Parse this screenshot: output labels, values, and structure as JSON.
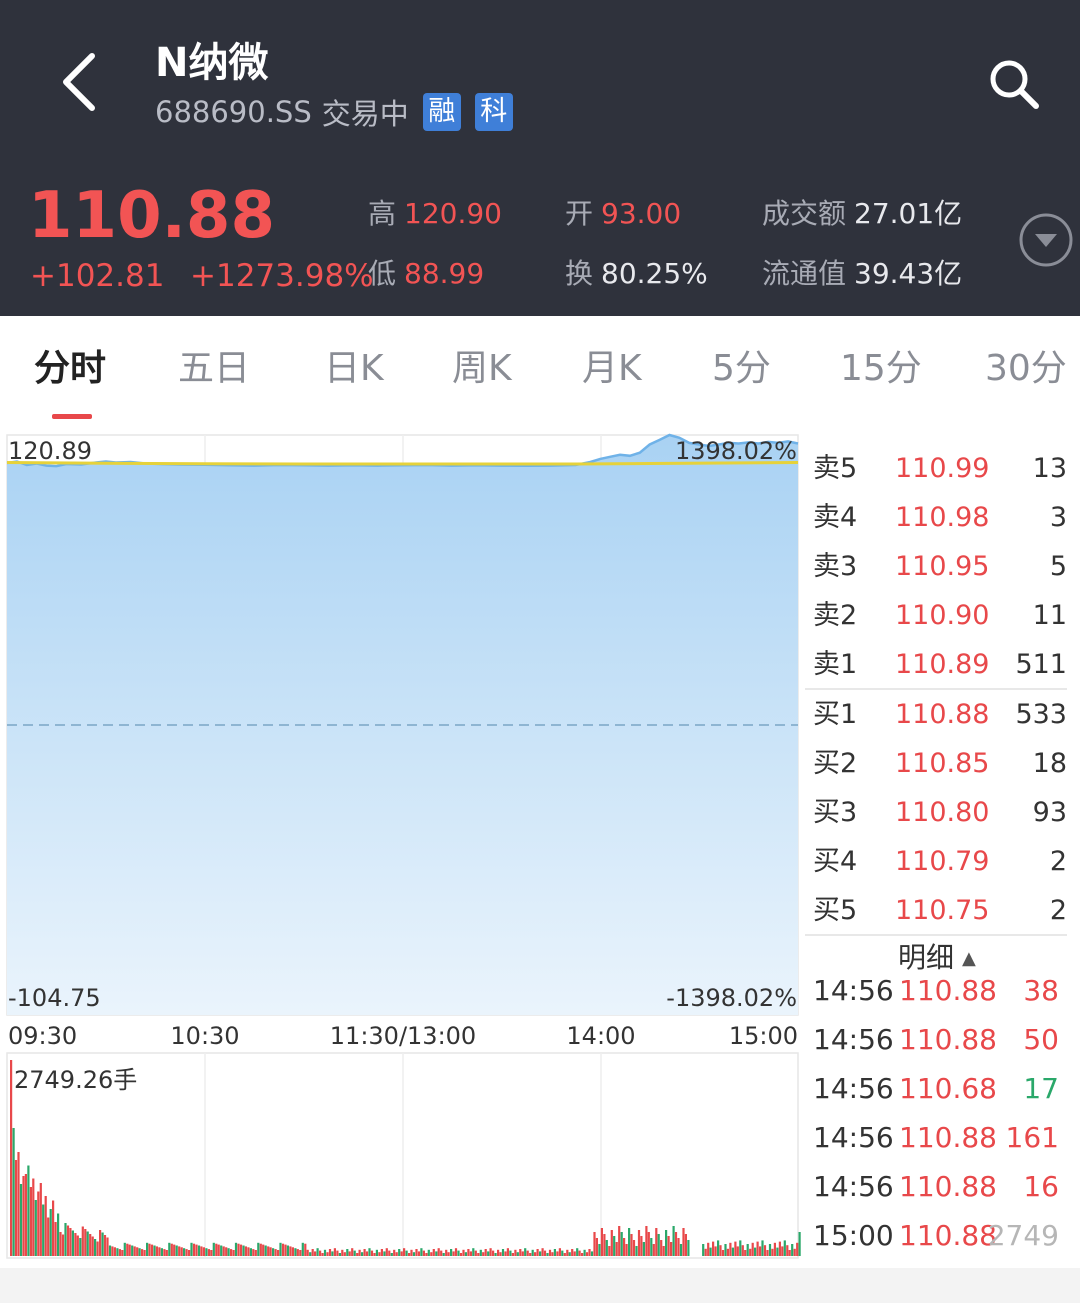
{
  "header": {
    "name": "N纳微",
    "code": "688690.SS",
    "status": "交易中",
    "badges": [
      "融",
      "科"
    ]
  },
  "quote": {
    "price": "110.88",
    "change": "+102.81",
    "change_pct": "+1273.98%",
    "high_label": "高",
    "high": "120.90",
    "low_label": "低",
    "low": "88.99",
    "open_label": "开",
    "open": "93.00",
    "turnover_label": "换",
    "turnover": "80.25%",
    "amount_label": "成交额",
    "amount": "27.01亿",
    "float_label": "流通值",
    "float_value": "39.43亿"
  },
  "tabs": [
    "分时",
    "五日",
    "日K",
    "周K",
    "月K",
    "5分",
    "15分",
    "30分"
  ],
  "chart": {
    "top_price": "120.89",
    "bottom_price": "-104.75",
    "top_pct": "1398.02%",
    "bottom_pct": "-1398.02%",
    "time_labels": [
      "09:30",
      "10:30",
      "11:30/13:00",
      "14:00",
      "15:00"
    ],
    "volume_label": "2749.26手"
  },
  "chart_data": {
    "type": "line",
    "x_label_ticks": [
      "09:30",
      "10:30",
      "11:30/13:00",
      "14:00",
      "15:00"
    ],
    "ylim": [
      -104.75,
      120.89
    ],
    "series": [
      {
        "values": [
          [
            0,
            110.0
          ],
          [
            4,
            110.6
          ],
          [
            8,
            109.2
          ],
          [
            12,
            109.8
          ],
          [
            16,
            109.0
          ],
          [
            20,
            108.8
          ],
          [
            24,
            109.6
          ],
          [
            30,
            109.4
          ],
          [
            36,
            110.2
          ],
          [
            40,
            110.6
          ],
          [
            44,
            110.2
          ],
          [
            50,
            110.4
          ],
          [
            56,
            109.8
          ],
          [
            62,
            109.6
          ],
          [
            70,
            109.4
          ],
          [
            80,
            109.3
          ],
          [
            90,
            109.1
          ],
          [
            100,
            109.0
          ],
          [
            110,
            109.2
          ],
          [
            120,
            109.1
          ],
          [
            130,
            109.0
          ],
          [
            140,
            109.1
          ],
          [
            150,
            109.0
          ],
          [
            160,
            109.1
          ],
          [
            170,
            109.2
          ],
          [
            180,
            109.0
          ],
          [
            190,
            109.1
          ],
          [
            200,
            109.0
          ],
          [
            210,
            108.9
          ],
          [
            220,
            109.0
          ],
          [
            230,
            109.2
          ],
          [
            236,
            110.4
          ],
          [
            240,
            111.6
          ],
          [
            244,
            112.4
          ],
          [
            248,
            113.2
          ],
          [
            252,
            112.8
          ],
          [
            256,
            114.0
          ],
          [
            260,
            117.2
          ],
          [
            264,
            119.0
          ],
          [
            268,
            120.9
          ],
          [
            272,
            119.8
          ],
          [
            276,
            117.8
          ],
          [
            280,
            117.2
          ],
          [
            284,
            116.6
          ],
          [
            288,
            117.2
          ],
          [
            292,
            117.8
          ],
          [
            296,
            117.6
          ],
          [
            300,
            118.0
          ],
          [
            304,
            117.6
          ],
          [
            308,
            118.2
          ],
          [
            312,
            117.8
          ],
          [
            316,
            118.4
          ],
          [
            320,
            117.6
          ]
        ]
      },
      {
        "values": [
          [
            0,
            110.2
          ],
          [
            40,
            109.9
          ],
          [
            80,
            109.7
          ],
          [
            120,
            109.6
          ],
          [
            160,
            109.6
          ],
          [
            200,
            109.6
          ],
          [
            230,
            109.6
          ],
          [
            260,
            109.8
          ],
          [
            290,
            110.0
          ],
          [
            320,
            110.2
          ]
        ]
      }
    ],
    "volume_bars_max": 2749.26
  },
  "orderbook": {
    "asks": [
      {
        "label": "卖5",
        "price": "110.99",
        "vol": "13"
      },
      {
        "label": "卖4",
        "price": "110.98",
        "vol": "3"
      },
      {
        "label": "卖3",
        "price": "110.95",
        "vol": "5"
      },
      {
        "label": "卖2",
        "price": "110.90",
        "vol": "11"
      },
      {
        "label": "卖1",
        "price": "110.89",
        "vol": "511"
      }
    ],
    "bids": [
      {
        "label": "买1",
        "price": "110.88",
        "vol": "533"
      },
      {
        "label": "买2",
        "price": "110.85",
        "vol": "18"
      },
      {
        "label": "买3",
        "price": "110.80",
        "vol": "93"
      },
      {
        "label": "买4",
        "price": "110.79",
        "vol": "2"
      },
      {
        "label": "买5",
        "price": "110.75",
        "vol": "2"
      }
    ]
  },
  "ticks": {
    "title": "明细",
    "rows": [
      {
        "time": "14:56",
        "price": "110.88",
        "vol": "38",
        "side": "red"
      },
      {
        "time": "14:56",
        "price": "110.88",
        "vol": "50",
        "side": "red"
      },
      {
        "time": "14:56",
        "price": "110.68",
        "vol": "17",
        "side": "green"
      },
      {
        "time": "14:56",
        "price": "110.88",
        "vol": "161",
        "side": "red"
      },
      {
        "time": "14:56",
        "price": "110.88",
        "vol": "16",
        "side": "red"
      },
      {
        "time": "15:00",
        "price": "110.88",
        "vol": "2749",
        "side": "gray"
      }
    ]
  },
  "colors": {
    "up": "#f25454",
    "down": "#2aa86a",
    "header_bg": "#2f323c",
    "price_line": "#6fb2e8",
    "avg_line": "#e6d23a"
  }
}
